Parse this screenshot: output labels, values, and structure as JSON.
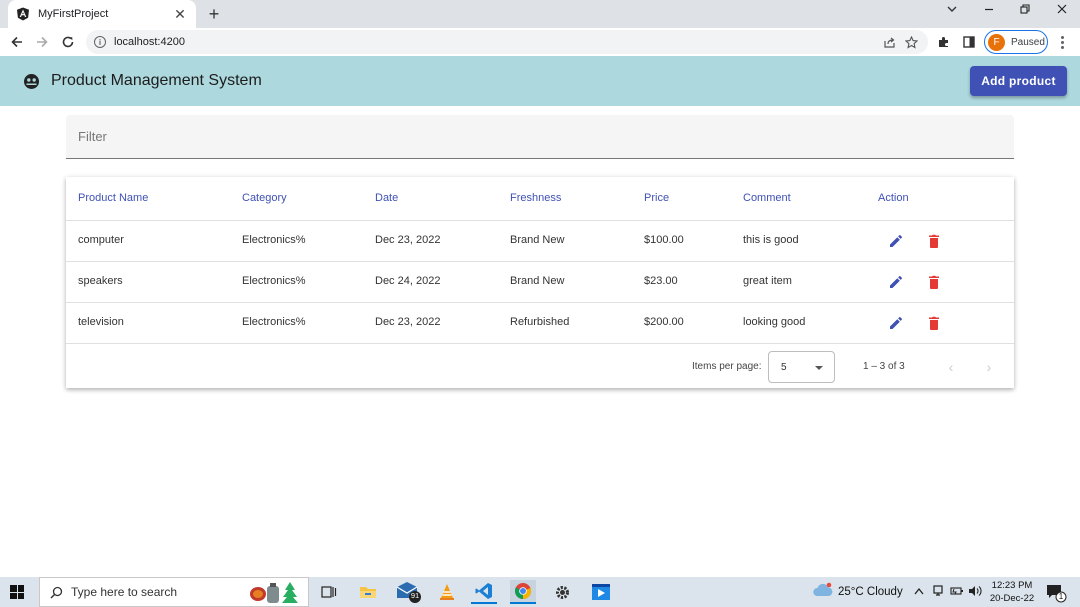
{
  "browser": {
    "tab_title": "MyFirstProject",
    "tab_close": "✕",
    "new_tab": "+",
    "url": "localhost:4200",
    "profile_initial": "F",
    "profile_status": "Paused"
  },
  "app": {
    "title": "Product Management System",
    "add_button": "Add product",
    "filter_placeholder": "Filter",
    "accent_color": "#3f51b5",
    "toolbar_color": "#add8de",
    "delete_color": "#e53935"
  },
  "table": {
    "headers": [
      "Product Name",
      "Category",
      "Date",
      "Freshness",
      "Price",
      "Comment",
      "Action"
    ],
    "rows": [
      [
        "computer",
        "Electronics%",
        "Dec 23, 2022",
        "Brand New",
        "$100.00",
        "this is good"
      ],
      [
        "speakers",
        "Electronics%",
        "Dec 24, 2022",
        "Brand New",
        "$23.00",
        "great item"
      ],
      [
        "television",
        "Electronics%",
        "Dec 23, 2022",
        "Refurbished",
        "$200.00",
        "looking good"
      ]
    ]
  },
  "paginator": {
    "items_per_page_label": "Items per page:",
    "items_per_page_value": "5",
    "range_label": "1 – 3 of 3",
    "prev": "‹",
    "next": "›"
  },
  "taskbar": {
    "search_placeholder": "Type here to search",
    "mail_badge": "91",
    "weather": "25°C  Cloudy",
    "time": "12:23 PM",
    "date": "20-Dec-22",
    "notification_badge": "1"
  }
}
